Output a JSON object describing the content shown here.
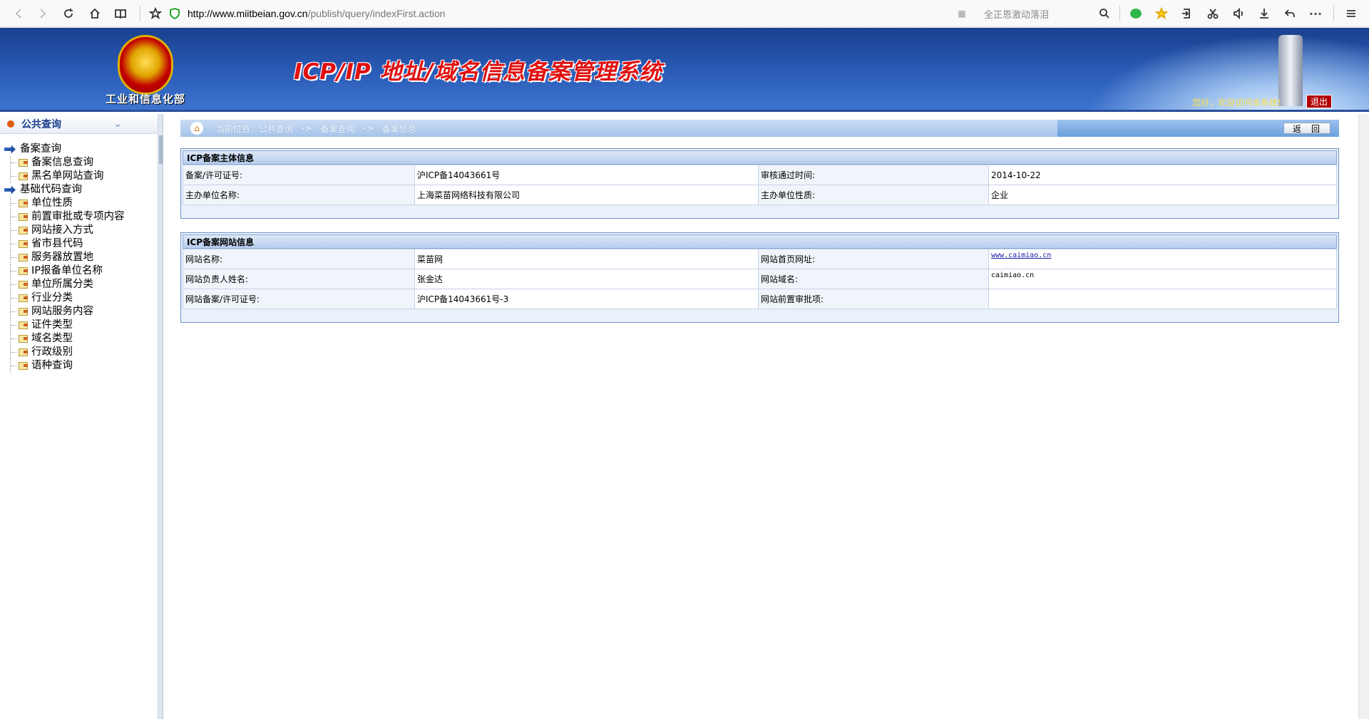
{
  "browser": {
    "url_host": "http://www.miitbeian.gov.cn",
    "url_path": "/publish/query/indexFirst.action",
    "search_placeholder": "全正恩激动落泪",
    "icons": [
      "back-icon",
      "forward-icon",
      "reload-icon",
      "home-icon",
      "reader-icon",
      "bookmark-star-icon",
      "shield-icon",
      "qr-icon",
      "search-icon",
      "wechat-icon",
      "star-icon",
      "sync-icon",
      "scissors-icon",
      "speaker-icon",
      "download-icon",
      "undo-icon",
      "more-icon",
      "menu-icon"
    ]
  },
  "banner": {
    "ministry": "工业和信息化部",
    "title": "ICP/IP 地址/域名信息备案管理系统",
    "welcome": "您好，欢迎访问本系统!",
    "logout": "退出"
  },
  "sidebar": {
    "header": "公共查询",
    "groups": [
      {
        "label": "备案查询",
        "items": [
          "备案信息查询",
          "黑名单网站查询"
        ]
      },
      {
        "label": "基础代码查询",
        "items": [
          "单位性质",
          "前置审批或专项内容",
          "网站接入方式",
          "省市县代码",
          "服务器放置地",
          "IP报备单位名称",
          "单位所属分类",
          "行业分类",
          "网站服务内容",
          "证件类型",
          "域名类型",
          "行政级别",
          "语种查询"
        ]
      }
    ]
  },
  "breadcrumb": {
    "prefix": "当前位置：公共查询",
    "arrow": "->",
    "level2": "备案查询",
    "level3": "备案信息",
    "back": "返回"
  },
  "entity_panel": {
    "title": "ICP备案主体信息",
    "rows": [
      {
        "l1": "备案/许可证号:",
        "v1": "沪ICP备14043661号",
        "l2": "审核通过时间:",
        "v2": "2014-10-22"
      },
      {
        "l1": "主办单位名称:",
        "v1": "上海菜苗网络科技有限公司",
        "l2": "主办单位性质:",
        "v2": "企业"
      }
    ]
  },
  "site_panel": {
    "title": "ICP备案网站信息",
    "rows": [
      {
        "l1": "网站名称:",
        "v1": "菜苗网",
        "l2": "网站首页网址:",
        "v2": "www.caimiao.cn"
      },
      {
        "l1": "网站负责人姓名:",
        "v1": "张金达",
        "l2": "网站域名:",
        "v2": "caimiao.cn"
      },
      {
        "l1": "网站备案/许可证号:",
        "v1": "沪ICP备14043661号-3",
        "l2": "网站前置审批项:",
        "v2": ""
      }
    ]
  }
}
